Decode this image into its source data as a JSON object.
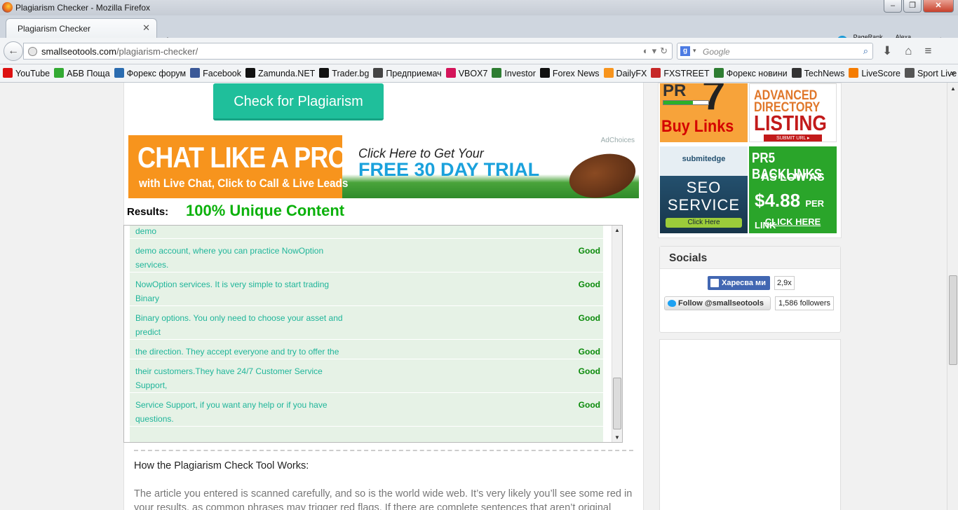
{
  "window": {
    "title": "Plagiarism Checker - Mozilla Firefox",
    "controls": [
      "–",
      "❐",
      "✕"
    ]
  },
  "tabs": [
    {
      "label": "Plagiarism Checker"
    }
  ],
  "toolbar_right": {
    "pagerank": "PageRank",
    "alexa": "Alexa"
  },
  "url": {
    "host": "smallseotools.com",
    "path": "/plagiarism-checker/"
  },
  "search": {
    "placeholder": "Google",
    "engine": "g"
  },
  "bookmarks": [
    {
      "label": "YouTube",
      "color": "#d11"
    },
    {
      "label": "АБВ Поща",
      "color": "#3a3"
    },
    {
      "label": "Форекс форум",
      "color": "#2b6cb0"
    },
    {
      "label": "Facebook",
      "color": "#3b5998"
    },
    {
      "label": "Zamunda.NET",
      "color": "#111"
    },
    {
      "label": "Trader.bg",
      "color": "#111"
    },
    {
      "label": "Предприемач",
      "color": "#444"
    },
    {
      "label": "VBOX7",
      "color": "#d4145a"
    },
    {
      "label": "Investor",
      "color": "#2e7d32"
    },
    {
      "label": "Forex News",
      "color": "#111"
    },
    {
      "label": "DailyFX",
      "color": "#f7941d"
    },
    {
      "label": "FXSTREET",
      "color": "#c62828"
    },
    {
      "label": "Форекс новини",
      "color": "#2e7d32"
    },
    {
      "label": "TechNews",
      "color": "#333"
    },
    {
      "label": "LiveScore",
      "color": "#f57c00"
    },
    {
      "label": "Sport Live",
      "color": "#555"
    }
  ],
  "main": {
    "check_button": "Check for Plagiarism",
    "ad": {
      "headline": "CHAT LIKE A PRO!",
      "sub": "with Live Chat, Click to Call & Live Leads",
      "click": "Click Here to Get Your",
      "trial": "FREE 30 DAY TRIAL",
      "adchoices": "AdChoices"
    },
    "results_label": "Results:",
    "unique_label": "100% Unique Content",
    "results": [
      {
        "text": "demo",
        "status": ""
      },
      {
        "text": "demo account, where you can practice NowOption services.",
        "status": "Good"
      },
      {
        "text": "NowOption services. It is very simple to start trading Binary",
        "status": "Good"
      },
      {
        "text": "Binary options. You only need to choose your asset and predict",
        "status": "Good"
      },
      {
        "text": "the direction. They accept everyone and try to offer the",
        "status": "Good"
      },
      {
        "text": "their customers.They have 24/7 Customer Service Support,",
        "status": "Good"
      },
      {
        "text": "Service Support, if you want any help or if you have questions.",
        "status": "Good"
      }
    ],
    "how_title": "How the Plagiarism Check Tool Works:",
    "how_text": "The article you entered is scanned carefully, and so is the world wide web. It’s very likely you’ll see some red in your results, as common phrases may trigger red flags. If there are complete sentences that aren’t original"
  },
  "sidebar": {
    "ads": {
      "pr7": {
        "pr": "PR",
        "num": "7",
        "buy": "Buy Links"
      },
      "directory": {
        "l1": "ADVANCED",
        "l2": "DIRECTORY",
        "l3": "LISTING",
        "submit": "SUBMIT URL ▸"
      },
      "seo": {
        "brand": "submitedge",
        "l1": "SEO",
        "l2": "SERVICE",
        "click": "Click Here"
      },
      "pr5": {
        "title": "PR5 BACKLINKS",
        "as_low": "AS LOW AS",
        "price": "$4.88",
        "per": "PER LINK",
        "click": "CLICK HERE"
      }
    },
    "socials": {
      "title": "Socials",
      "fb_like": "Харесва ми",
      "fb_count": "2,9x",
      "tw_follow": "Follow @smallseotools",
      "tw_count": "1,586 followers"
    }
  }
}
